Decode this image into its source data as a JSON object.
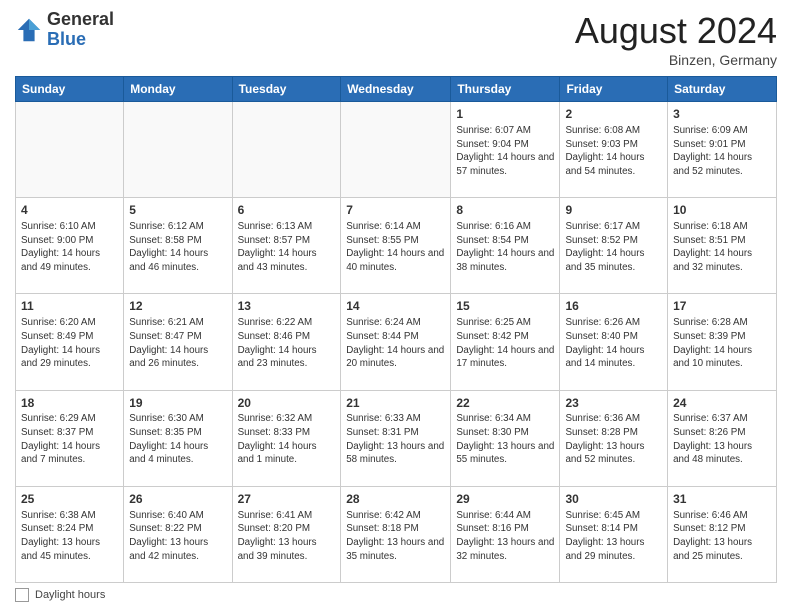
{
  "header": {
    "logo_general": "General",
    "logo_blue": "Blue",
    "month_title": "August 2024",
    "subtitle": "Binzen, Germany"
  },
  "days_of_week": [
    "Sunday",
    "Monday",
    "Tuesday",
    "Wednesday",
    "Thursday",
    "Friday",
    "Saturday"
  ],
  "footer": {
    "label": "Daylight hours"
  },
  "weeks": [
    [
      {
        "day": "",
        "info": ""
      },
      {
        "day": "",
        "info": ""
      },
      {
        "day": "",
        "info": ""
      },
      {
        "day": "",
        "info": ""
      },
      {
        "day": "1",
        "info": "Sunrise: 6:07 AM\nSunset: 9:04 PM\nDaylight: 14 hours and 57 minutes."
      },
      {
        "day": "2",
        "info": "Sunrise: 6:08 AM\nSunset: 9:03 PM\nDaylight: 14 hours and 54 minutes."
      },
      {
        "day": "3",
        "info": "Sunrise: 6:09 AM\nSunset: 9:01 PM\nDaylight: 14 hours and 52 minutes."
      }
    ],
    [
      {
        "day": "4",
        "info": "Sunrise: 6:10 AM\nSunset: 9:00 PM\nDaylight: 14 hours and 49 minutes."
      },
      {
        "day": "5",
        "info": "Sunrise: 6:12 AM\nSunset: 8:58 PM\nDaylight: 14 hours and 46 minutes."
      },
      {
        "day": "6",
        "info": "Sunrise: 6:13 AM\nSunset: 8:57 PM\nDaylight: 14 hours and 43 minutes."
      },
      {
        "day": "7",
        "info": "Sunrise: 6:14 AM\nSunset: 8:55 PM\nDaylight: 14 hours and 40 minutes."
      },
      {
        "day": "8",
        "info": "Sunrise: 6:16 AM\nSunset: 8:54 PM\nDaylight: 14 hours and 38 minutes."
      },
      {
        "day": "9",
        "info": "Sunrise: 6:17 AM\nSunset: 8:52 PM\nDaylight: 14 hours and 35 minutes."
      },
      {
        "day": "10",
        "info": "Sunrise: 6:18 AM\nSunset: 8:51 PM\nDaylight: 14 hours and 32 minutes."
      }
    ],
    [
      {
        "day": "11",
        "info": "Sunrise: 6:20 AM\nSunset: 8:49 PM\nDaylight: 14 hours and 29 minutes."
      },
      {
        "day": "12",
        "info": "Sunrise: 6:21 AM\nSunset: 8:47 PM\nDaylight: 14 hours and 26 minutes."
      },
      {
        "day": "13",
        "info": "Sunrise: 6:22 AM\nSunset: 8:46 PM\nDaylight: 14 hours and 23 minutes."
      },
      {
        "day": "14",
        "info": "Sunrise: 6:24 AM\nSunset: 8:44 PM\nDaylight: 14 hours and 20 minutes."
      },
      {
        "day": "15",
        "info": "Sunrise: 6:25 AM\nSunset: 8:42 PM\nDaylight: 14 hours and 17 minutes."
      },
      {
        "day": "16",
        "info": "Sunrise: 6:26 AM\nSunset: 8:40 PM\nDaylight: 14 hours and 14 minutes."
      },
      {
        "day": "17",
        "info": "Sunrise: 6:28 AM\nSunset: 8:39 PM\nDaylight: 14 hours and 10 minutes."
      }
    ],
    [
      {
        "day": "18",
        "info": "Sunrise: 6:29 AM\nSunset: 8:37 PM\nDaylight: 14 hours and 7 minutes."
      },
      {
        "day": "19",
        "info": "Sunrise: 6:30 AM\nSunset: 8:35 PM\nDaylight: 14 hours and 4 minutes."
      },
      {
        "day": "20",
        "info": "Sunrise: 6:32 AM\nSunset: 8:33 PM\nDaylight: 14 hours and 1 minute."
      },
      {
        "day": "21",
        "info": "Sunrise: 6:33 AM\nSunset: 8:31 PM\nDaylight: 13 hours and 58 minutes."
      },
      {
        "day": "22",
        "info": "Sunrise: 6:34 AM\nSunset: 8:30 PM\nDaylight: 13 hours and 55 minutes."
      },
      {
        "day": "23",
        "info": "Sunrise: 6:36 AM\nSunset: 8:28 PM\nDaylight: 13 hours and 52 minutes."
      },
      {
        "day": "24",
        "info": "Sunrise: 6:37 AM\nSunset: 8:26 PM\nDaylight: 13 hours and 48 minutes."
      }
    ],
    [
      {
        "day": "25",
        "info": "Sunrise: 6:38 AM\nSunset: 8:24 PM\nDaylight: 13 hours and 45 minutes."
      },
      {
        "day": "26",
        "info": "Sunrise: 6:40 AM\nSunset: 8:22 PM\nDaylight: 13 hours and 42 minutes."
      },
      {
        "day": "27",
        "info": "Sunrise: 6:41 AM\nSunset: 8:20 PM\nDaylight: 13 hours and 39 minutes."
      },
      {
        "day": "28",
        "info": "Sunrise: 6:42 AM\nSunset: 8:18 PM\nDaylight: 13 hours and 35 minutes."
      },
      {
        "day": "29",
        "info": "Sunrise: 6:44 AM\nSunset: 8:16 PM\nDaylight: 13 hours and 32 minutes."
      },
      {
        "day": "30",
        "info": "Sunrise: 6:45 AM\nSunset: 8:14 PM\nDaylight: 13 hours and 29 minutes."
      },
      {
        "day": "31",
        "info": "Sunrise: 6:46 AM\nSunset: 8:12 PM\nDaylight: 13 hours and 25 minutes."
      }
    ]
  ]
}
